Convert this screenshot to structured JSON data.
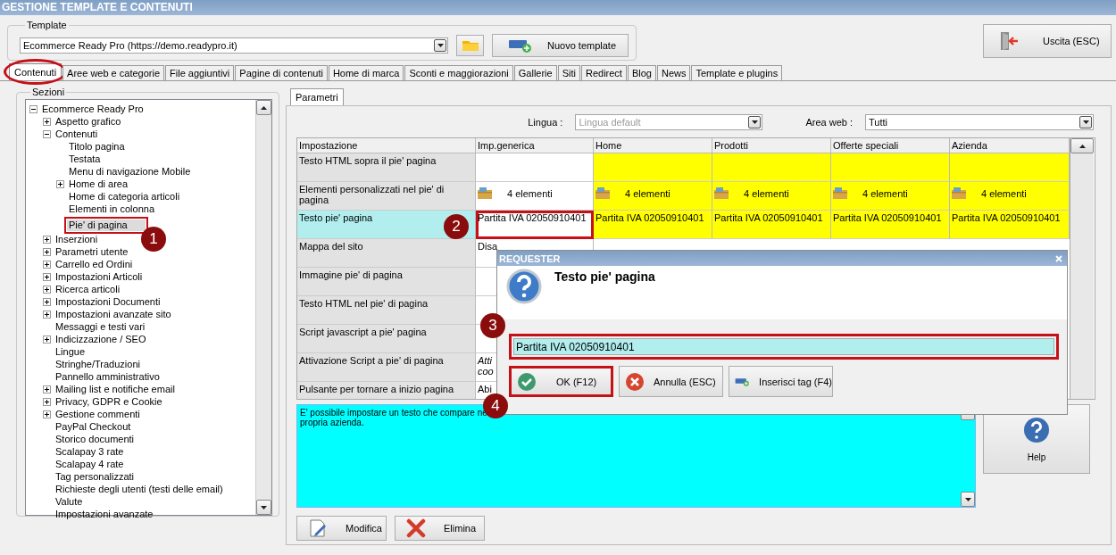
{
  "window": {
    "title": "GESTIONE TEMPLATE E CONTENUTI"
  },
  "template": {
    "legend": "Template",
    "value": "Ecommerce Ready Pro (https://demo.readypro.it)",
    "new_button": "Nuovo template"
  },
  "exit_button": "Uscita (ESC)",
  "tabs": [
    {
      "label": "Contenuti",
      "selected": true,
      "circled": true
    },
    {
      "label": "Aree web e categorie",
      "selected": false,
      "circled": false
    },
    {
      "label": "File aggiuntivi",
      "selected": false,
      "circled": false
    },
    {
      "label": "Pagine di contenuti",
      "selected": false,
      "circled": false
    },
    {
      "label": "Home di marca",
      "selected": false,
      "circled": false
    },
    {
      "label": "Sconti e maggiorazioni",
      "selected": false,
      "circled": false
    },
    {
      "label": "Gallerie",
      "selected": false,
      "circled": false
    },
    {
      "label": "Siti",
      "selected": false,
      "circled": false
    },
    {
      "label": "Redirect",
      "selected": false,
      "circled": false
    },
    {
      "label": "Blog",
      "selected": false,
      "circled": false
    },
    {
      "label": "News",
      "selected": false,
      "circled": false
    },
    {
      "label": "Template e plugins",
      "selected": false,
      "circled": false
    }
  ],
  "sections": {
    "legend": "Sezioni",
    "tree": [
      {
        "label": "Ecommerce Ready Pro",
        "kind": "folder",
        "expanded": true,
        "selected": false,
        "highlighted": false,
        "children": [
          {
            "label": "Aspetto grafico",
            "kind": "folder",
            "expanded": false,
            "selected": false,
            "highlighted": false
          },
          {
            "label": "Contenuti",
            "kind": "folder",
            "expanded": true,
            "selected": false,
            "highlighted": false,
            "children": [
              {
                "label": "Titolo pagina",
                "kind": "leaf",
                "selected": false,
                "highlighted": false
              },
              {
                "label": "Testata",
                "kind": "leaf",
                "selected": false,
                "highlighted": false
              },
              {
                "label": "Menu di navigazione Mobile",
                "kind": "leaf",
                "selected": false,
                "highlighted": false
              },
              {
                "label": "Home di area",
                "kind": "folder",
                "expanded": false,
                "selected": false,
                "highlighted": false
              },
              {
                "label": "Home di categoria articoli",
                "kind": "leaf",
                "selected": false,
                "highlighted": false
              },
              {
                "label": "Elementi in colonna",
                "kind": "leaf",
                "selected": false,
                "highlighted": false
              },
              {
                "label": "Pie' di pagina",
                "kind": "leaf",
                "selected": true,
                "highlighted": true
              }
            ]
          },
          {
            "label": "Inserzioni",
            "kind": "folder",
            "expanded": false,
            "selected": false,
            "highlighted": false
          },
          {
            "label": "Parametri utente",
            "kind": "folder",
            "expanded": false,
            "selected": false,
            "highlighted": false
          },
          {
            "label": "Carrello ed Ordini",
            "kind": "folder",
            "expanded": false,
            "selected": false,
            "highlighted": false
          },
          {
            "label": "Impostazioni Articoli",
            "kind": "folder",
            "expanded": false,
            "selected": false,
            "highlighted": false
          },
          {
            "label": "Ricerca articoli",
            "kind": "folder",
            "expanded": false,
            "selected": false,
            "highlighted": false
          },
          {
            "label": "Impostazioni Documenti",
            "kind": "folder",
            "expanded": false,
            "selected": false,
            "highlighted": false
          },
          {
            "label": "Impostazioni avanzate sito",
            "kind": "folder",
            "expanded": false,
            "selected": false,
            "highlighted": false
          },
          {
            "label": "Messaggi e testi vari",
            "kind": "leaf",
            "selected": false,
            "highlighted": false
          },
          {
            "label": "Indicizzazione / SEO",
            "kind": "folder",
            "expanded": false,
            "selected": false,
            "highlighted": false
          },
          {
            "label": "Lingue",
            "kind": "leaf",
            "selected": false,
            "highlighted": false
          },
          {
            "label": "Stringhe/Traduzioni",
            "kind": "leaf",
            "selected": false,
            "highlighted": false
          },
          {
            "label": "Pannello amministrativo",
            "kind": "leaf",
            "selected": false,
            "highlighted": false
          },
          {
            "label": "Mailing list e notifiche email",
            "kind": "folder",
            "expanded": false,
            "selected": false,
            "highlighted": false
          },
          {
            "label": "Privacy, GDPR e Cookie",
            "kind": "folder",
            "expanded": false,
            "selected": false,
            "highlighted": false
          },
          {
            "label": "Gestione commenti",
            "kind": "folder",
            "expanded": false,
            "selected": false,
            "highlighted": false
          },
          {
            "label": "PayPal Checkout",
            "kind": "leaf",
            "selected": false,
            "highlighted": false
          },
          {
            "label": "Storico documenti",
            "kind": "leaf",
            "selected": false,
            "highlighted": false
          },
          {
            "label": "Scalapay 3 rate",
            "kind": "leaf",
            "selected": false,
            "highlighted": false
          },
          {
            "label": "Scalapay 4 rate",
            "kind": "leaf",
            "selected": false,
            "highlighted": false
          },
          {
            "label": "Tag personalizzati",
            "kind": "leaf",
            "selected": false,
            "highlighted": false
          },
          {
            "label": "Richieste degli utenti (testi delle email)",
            "kind": "leaf",
            "selected": false,
            "highlighted": false
          },
          {
            "label": "Valute",
            "kind": "leaf",
            "selected": false,
            "highlighted": false
          },
          {
            "label": "Impostazioni avanzate",
            "kind": "leaf",
            "selected": false,
            "highlighted": false
          }
        ]
      }
    ]
  },
  "panel_tab": {
    "label": "Parametri",
    "selected": true
  },
  "filters": [
    {
      "label": "Lingua :",
      "value": "Lingua default",
      "disabled": true
    },
    {
      "label": "Area web :",
      "value": "Tutti",
      "disabled": false
    }
  ],
  "table": {
    "columns": [
      "Impostazione",
      "Imp.generica",
      "Home",
      "Prodotti",
      "Offerte speciali",
      "Azienda"
    ],
    "rows": [
      {
        "selected": false,
        "cells": [
          {
            "kind": "label",
            "text": "Testo HTML sopra il pie' pagina"
          },
          {
            "kind": "empty",
            "customized": false,
            "highlighted": false
          },
          {
            "kind": "empty",
            "customized": true,
            "highlighted": false
          },
          {
            "kind": "empty",
            "customized": true,
            "highlighted": false
          },
          {
            "kind": "empty",
            "customized": true,
            "highlighted": false
          },
          {
            "kind": "empty",
            "customized": true,
            "highlighted": false
          }
        ]
      },
      {
        "selected": false,
        "cells": [
          {
            "kind": "label",
            "text": "Elementi personalizzati nel pie' di pagina"
          },
          {
            "kind": "elements",
            "text": "4 elementi",
            "customized": false,
            "highlighted": false
          },
          {
            "kind": "elements",
            "text": "4 elementi",
            "customized": true,
            "highlighted": false
          },
          {
            "kind": "elements",
            "text": "4 elementi",
            "customized": true,
            "highlighted": false
          },
          {
            "kind": "elements",
            "text": "4 elementi",
            "customized": true,
            "highlighted": false
          },
          {
            "kind": "elements",
            "text": "4 elementi",
            "customized": true,
            "highlighted": false
          }
        ]
      },
      {
        "selected": true,
        "cells": [
          {
            "kind": "label",
            "text": "Testo pie' pagina"
          },
          {
            "kind": "text",
            "text": "Partita IVA 02050910401",
            "customized": false,
            "highlighted": true
          },
          {
            "kind": "text",
            "text": "Partita IVA 02050910401",
            "customized": true,
            "highlighted": false
          },
          {
            "kind": "text",
            "text": "Partita IVA 02050910401",
            "customized": true,
            "highlighted": false
          },
          {
            "kind": "text",
            "text": "Partita IVA 02050910401",
            "customized": true,
            "highlighted": false
          },
          {
            "kind": "text",
            "text": "Partita IVA 02050910401",
            "customized": true,
            "highlighted": false
          }
        ]
      },
      {
        "selected": false,
        "cells": [
          {
            "kind": "label",
            "text": "Mappa del sito"
          },
          {
            "kind": "text",
            "text": "Disa",
            "customized": false,
            "highlighted": false
          }
        ]
      },
      {
        "selected": false,
        "cells": [
          {
            "kind": "label",
            "text": "Immagine pie' di pagina"
          },
          {
            "kind": "empty",
            "customized": false,
            "highlighted": false
          }
        ]
      },
      {
        "selected": false,
        "cells": [
          {
            "kind": "label",
            "text": "Testo HTML nel pie' di pagina"
          },
          {
            "kind": "empty",
            "customized": false,
            "highlighted": false
          }
        ]
      },
      {
        "selected": false,
        "cells": [
          {
            "kind": "label",
            "text": "Script javascript a pie' pagina"
          },
          {
            "kind": "empty",
            "customized": false,
            "highlighted": false
          }
        ]
      },
      {
        "selected": false,
        "cells": [
          {
            "kind": "label",
            "text": "Attivazione Script a pie' di pagina"
          },
          {
            "kind": "italic",
            "text": "Atti\ncoo",
            "customized": false,
            "highlighted": false
          }
        ]
      },
      {
        "selected": false,
        "cells": [
          {
            "kind": "label",
            "text": "Pulsante per tornare a inizio pagina"
          },
          {
            "kind": "text",
            "text": "Abi",
            "customized": false,
            "highlighted": false
          }
        ]
      }
    ]
  },
  "description": {
    "lines": [
      "E' possibile impostare un testo che compare ne",
      "propria azienda."
    ]
  },
  "help_button": "Help",
  "actions": [
    {
      "label": "Modifica",
      "kind": "edit"
    },
    {
      "label": "Elimina",
      "kind": "delete"
    }
  ],
  "dialog": {
    "title": "REQUESTER",
    "heading": "Testo pie' pagina",
    "value": "Partita IVA 02050910401",
    "highlighted": true,
    "buttons": [
      {
        "label": "OK (F12)",
        "kind": "ok",
        "highlighted": true
      },
      {
        "label": "Annulla (ESC)",
        "kind": "cancel",
        "highlighted": false
      },
      {
        "label": "Inserisci tag (F4)",
        "kind": "tag",
        "highlighted": false
      }
    ]
  },
  "annotations": [
    {
      "label": "1"
    },
    {
      "label": "2"
    },
    {
      "label": "3"
    },
    {
      "label": "4"
    }
  ]
}
